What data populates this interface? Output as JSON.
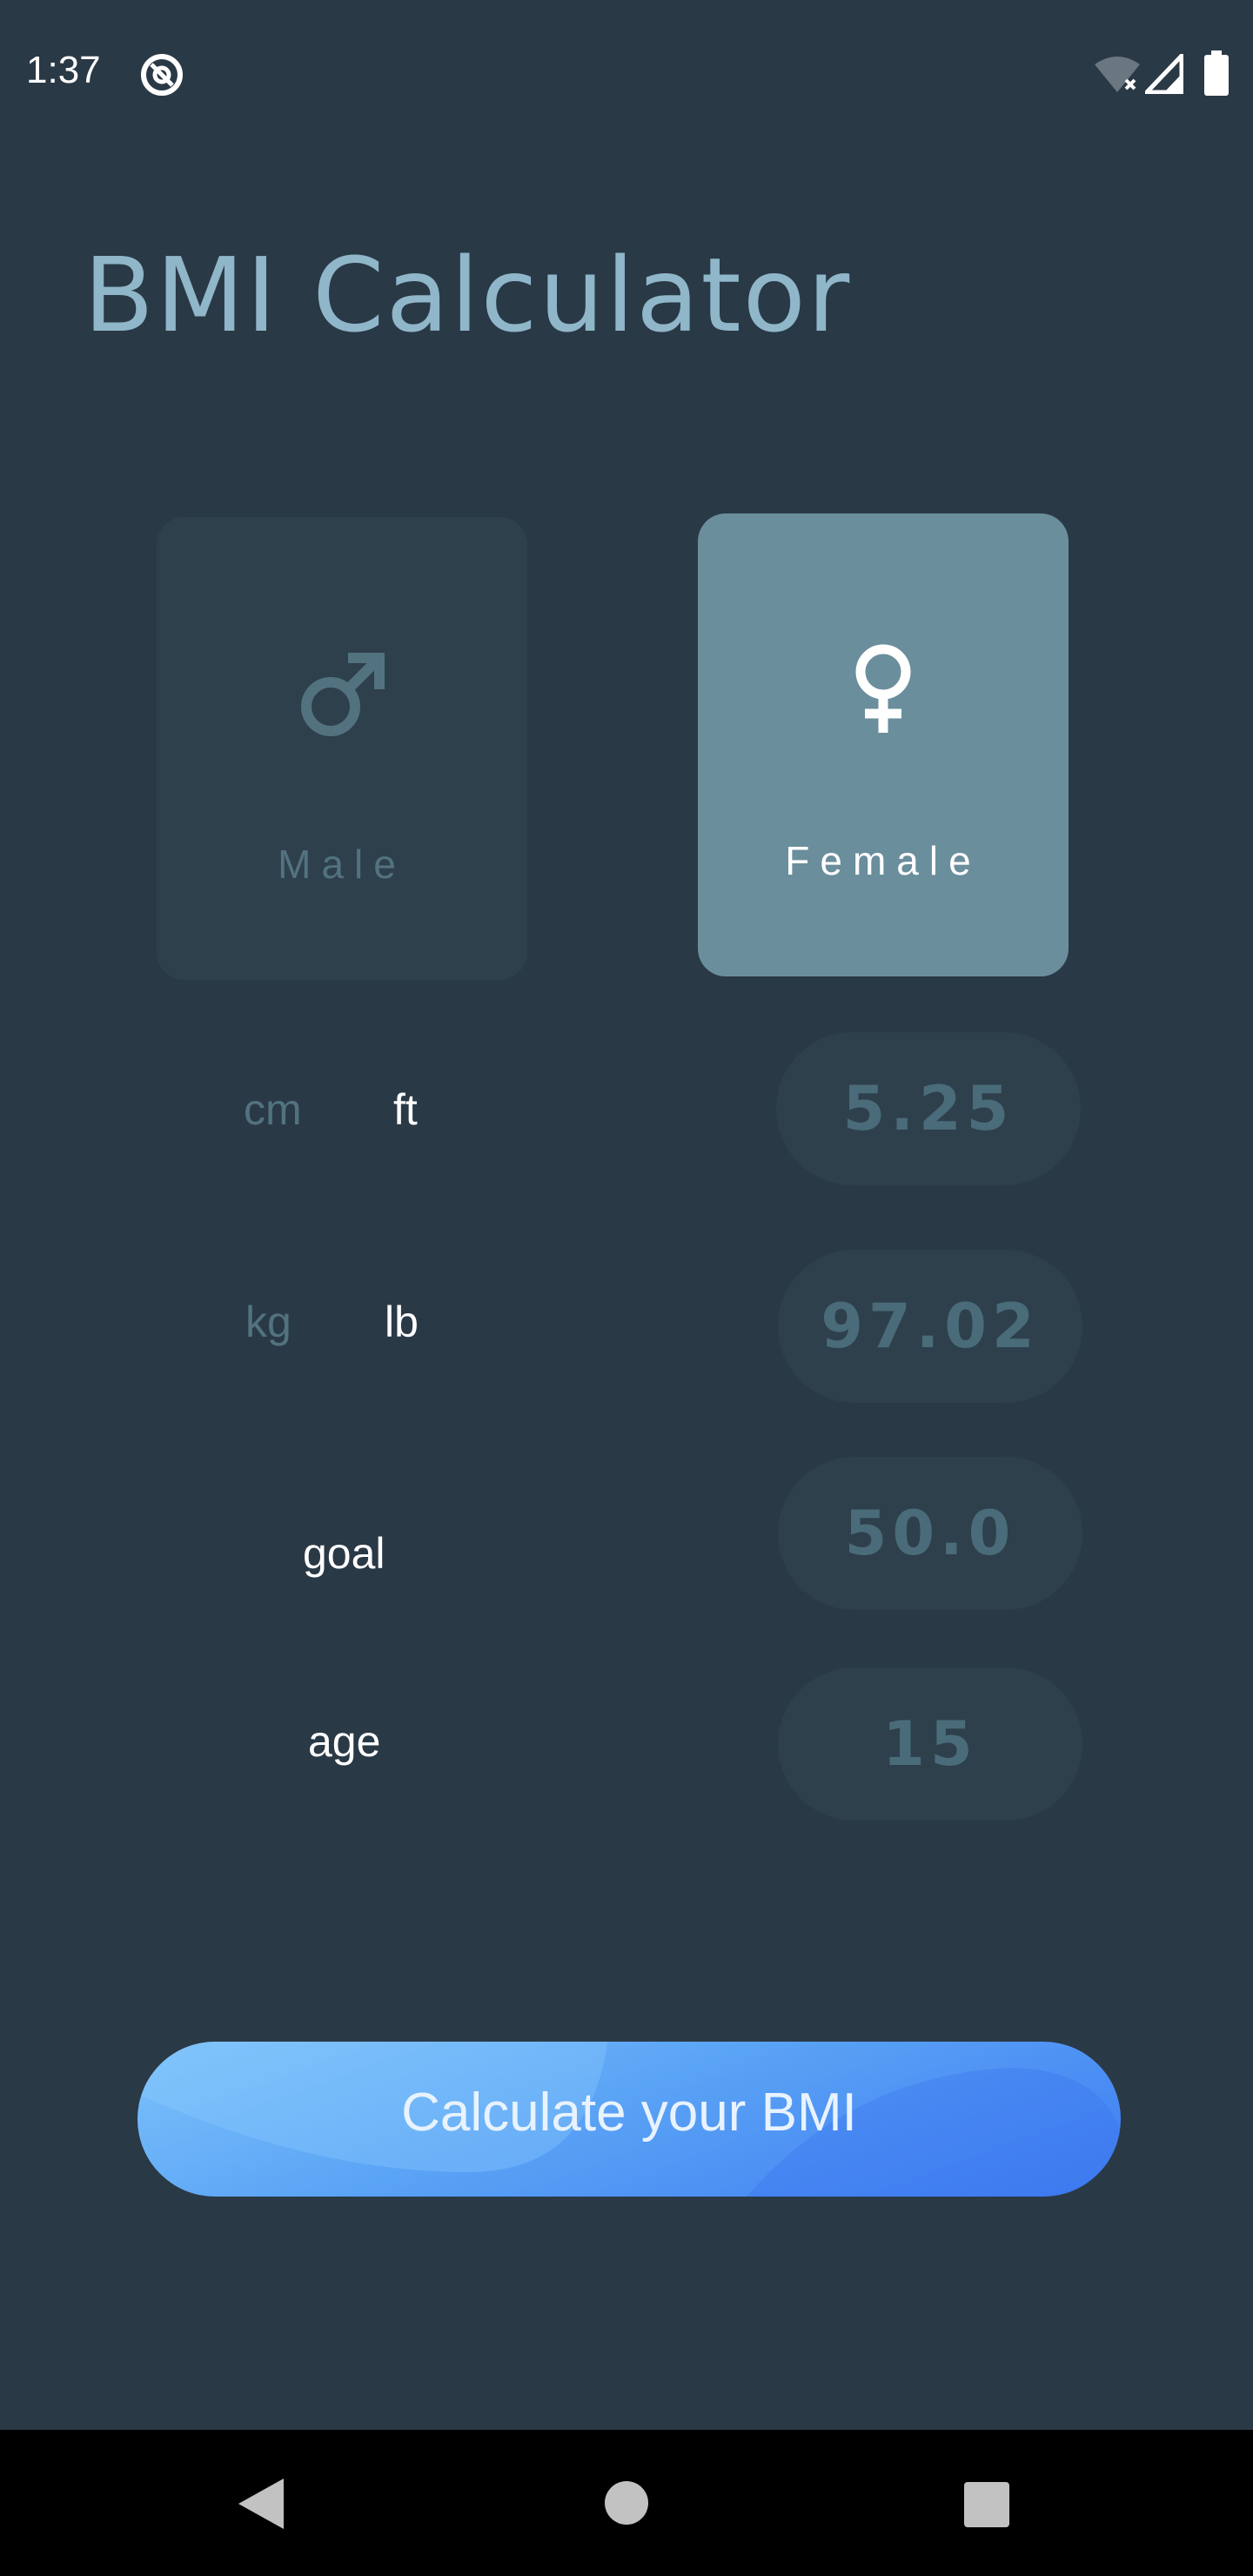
{
  "status_bar": {
    "time": "1:37",
    "icons": [
      "app-notification-icon",
      "wifi-off-icon",
      "signal-icon",
      "battery-icon"
    ]
  },
  "app": {
    "title": "BMI Calculator"
  },
  "gender": {
    "male_label": "Male",
    "female_label": "Female",
    "selected": "Female",
    "male_symbol": "♂",
    "female_symbol": "♀"
  },
  "height": {
    "unit_metric": "cm",
    "unit_imperial": "ft",
    "selected_unit": "ft",
    "value": "5.25"
  },
  "weight": {
    "unit_metric": "kg",
    "unit_imperial": "lb",
    "selected_unit": "lb",
    "value": "97.02"
  },
  "goal": {
    "label": "goal",
    "value": "50.0"
  },
  "age": {
    "label": "age",
    "value": "15"
  },
  "actions": {
    "calculate_label": "Calculate your BMI"
  },
  "colors": {
    "background": "#2a3946",
    "title": "#8fb6c9",
    "card_inactive": "#2e404c",
    "card_active": "#6a8e9c",
    "button_gradient_start": "#7cc2fb",
    "button_gradient_end": "#3e7cf2"
  },
  "nav_bar": {
    "icons": [
      "back-icon",
      "home-icon",
      "recents-icon"
    ]
  }
}
